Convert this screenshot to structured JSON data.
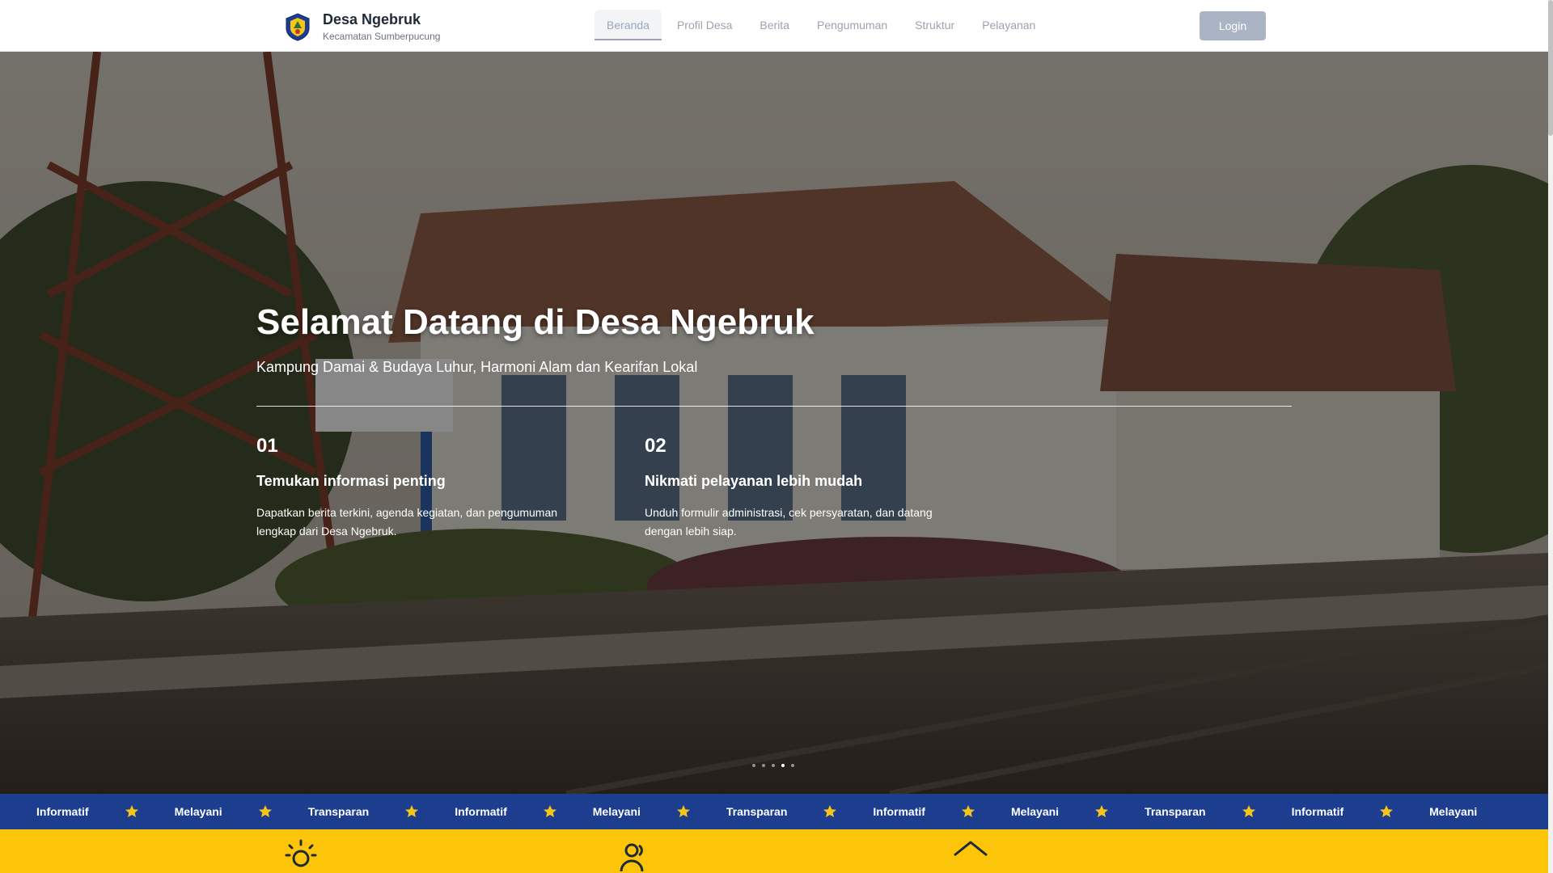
{
  "header": {
    "title": "Desa Ngebruk",
    "subtitle": "Kecamatan Sumberpucung",
    "logo_icon": "village-emblem-icon",
    "login_label": "Login"
  },
  "nav": {
    "items": [
      {
        "label": "Beranda",
        "active": true
      },
      {
        "label": "Profil Desa",
        "active": false
      },
      {
        "label": "Berita",
        "active": false
      },
      {
        "label": "Pengumuman",
        "active": false
      },
      {
        "label": "Struktur",
        "active": false
      },
      {
        "label": "Pelayanan",
        "active": false
      }
    ]
  },
  "hero": {
    "title": "Selamat Datang di Desa Ngebruk",
    "subtitle": "Kampung Damai & Budaya Luhur, Harmoni Alam dan Kearifan Lokal",
    "features": [
      {
        "num": "01",
        "title": "Temukan informasi penting",
        "desc": "Dapatkan berita terkini, agenda kegiatan, dan pengumuman lengkap dari Desa Ngebruk."
      },
      {
        "num": "02",
        "title": "Nikmati pelayanan lebih mudah",
        "desc": "Unduh formulir administrasi, cek persyaratan, dan datang dengan lebih siap."
      }
    ],
    "slides": {
      "count": 5,
      "active_index": 3
    }
  },
  "ticker": {
    "words": [
      "Informatif",
      "Melayani",
      "Transparan",
      "Informatif",
      "Melayani",
      "Transparan",
      "Informatif",
      "Melayani",
      "Transparan",
      "Informatif",
      "Melayani"
    ],
    "separator_icon": "star-icon"
  },
  "colors": {
    "brand_blue": "#1d3d8f",
    "accent_yellow": "#fcc50a",
    "star": "#f5c518"
  }
}
